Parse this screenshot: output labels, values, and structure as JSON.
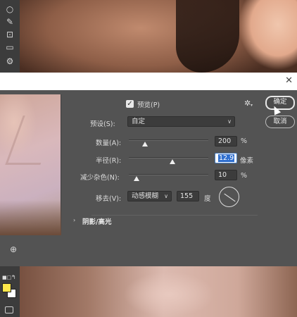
{
  "dialog": {
    "preview_label": "预览(P)",
    "preview_checked": true,
    "preset_label": "预设(S):",
    "preset_value": "自定",
    "amount_label": "数量(A):",
    "amount_value": "200",
    "amount_unit": "%",
    "amount_level": 0.2,
    "radius_label": "半径(R):",
    "radius_value": "12.9",
    "radius_unit": "像素",
    "radius_level": 0.55,
    "noise_label": "减少杂色(N):",
    "noise_value": "10",
    "noise_unit": "%",
    "noise_level": 0.1,
    "remove_label": "移去(V):",
    "remove_value": "动感模糊",
    "angle_value": "155",
    "angle_unit": "度",
    "section_title": "阴影/高光",
    "ok_label": "确定",
    "cancel_label": "取消"
  },
  "icons": {
    "tools": [
      "lasso-icon",
      "quick-select-icon",
      "crop-icon",
      "frame-icon",
      "gear-tool-icon"
    ],
    "close": "close-icon",
    "settings": "gear-icon",
    "zoom": "zoom-icon"
  },
  "colors": {
    "dialog_bg": "#535353",
    "field_bg": "#3c3c3c",
    "highlight": "#2f6fcf",
    "foreground_swatch": "#ffe84a",
    "background_swatch": "#ffffff"
  }
}
